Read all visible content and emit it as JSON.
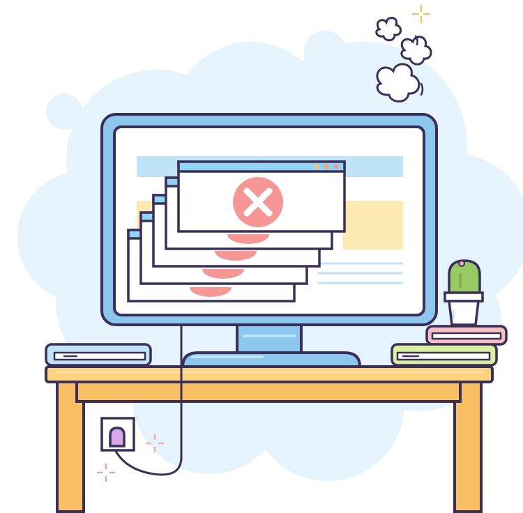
{
  "scene": {
    "description_icon": "computer-error-illustration",
    "error_icon": "close-x-icon",
    "stacked_windows": 5,
    "colors": {
      "outline": "#3A2F59",
      "sky": "#E5F4FC",
      "monitor_frame": "#BFE3F7",
      "monitor_bezel": "#8CC8EE",
      "screen": "#FFFFFF",
      "window_titlebar": "#8FD3F5",
      "error_circle": "#F69795",
      "desk_top": "#FDD37D",
      "desk_leg": "#F8C063",
      "book_blue": "#BFE3F7",
      "book_green": "#D9F0A0",
      "book_pink": "#F7BFC0",
      "cactus": "#97CA63",
      "plug": "#D3A9E8",
      "spark_orange": "#FBC16A",
      "spark_pink": "#F8A7B0",
      "spark_purple": "#C9A7E8"
    }
  }
}
